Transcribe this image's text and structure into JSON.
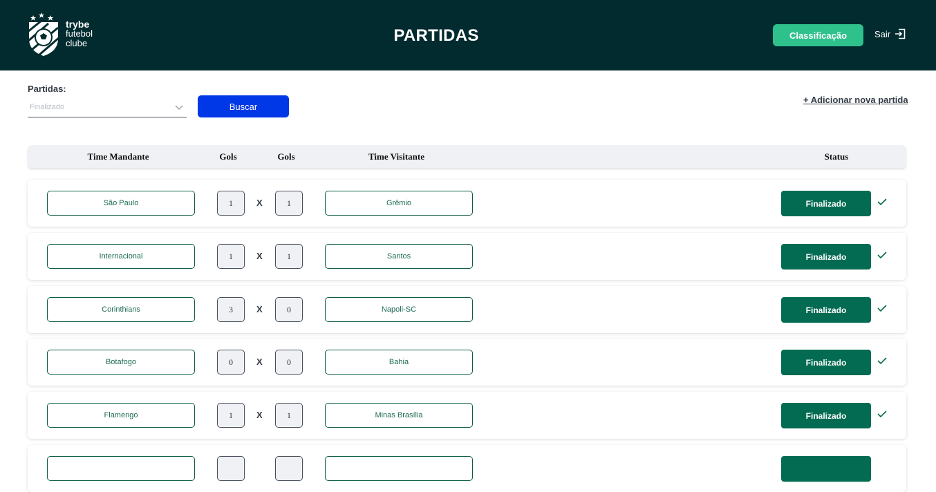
{
  "header": {
    "logo_line1": "trybe",
    "logo_line2": "futebol",
    "logo_line3": "clube",
    "title": "PARTIDAS",
    "ranking_label": "Classificação",
    "logout_label": "Sair",
    "logout_icon": "logout-icon"
  },
  "filter": {
    "label": "Partidas:",
    "selected": "Finalizado",
    "search_label": "Buscar",
    "add_link": "+ Adicionar nova partida"
  },
  "table": {
    "columns": [
      "Time Mandante",
      "Gols",
      "Gols",
      "Time Visitante",
      "Status"
    ],
    "vs_label": "X",
    "rows": [
      {
        "home": "São Paulo",
        "home_goals": "1",
        "away_goals": "1",
        "away": "Grêmio",
        "status": "Finalizado"
      },
      {
        "home": "Internacional",
        "home_goals": "1",
        "away_goals": "1",
        "away": "Santos",
        "status": "Finalizado"
      },
      {
        "home": "Corinthians",
        "home_goals": "3",
        "away_goals": "0",
        "away": "Napoli-SC",
        "status": "Finalizado"
      },
      {
        "home": "Botafogo",
        "home_goals": "0",
        "away_goals": "0",
        "away": "Bahia",
        "status": "Finalizado"
      },
      {
        "home": "Flamengo",
        "home_goals": "1",
        "away_goals": "1",
        "away": "Minas Brasília",
        "status": "Finalizado"
      },
      {
        "home": "",
        "home_goals": "",
        "away_goals": "",
        "away": "",
        "status": ""
      }
    ]
  },
  "colors": {
    "header_bg": "#012b2f",
    "ranking_button": "#2fc18c",
    "search_button": "#0037e6",
    "status_button": "#036b52",
    "team_border": "#0d5c48"
  }
}
